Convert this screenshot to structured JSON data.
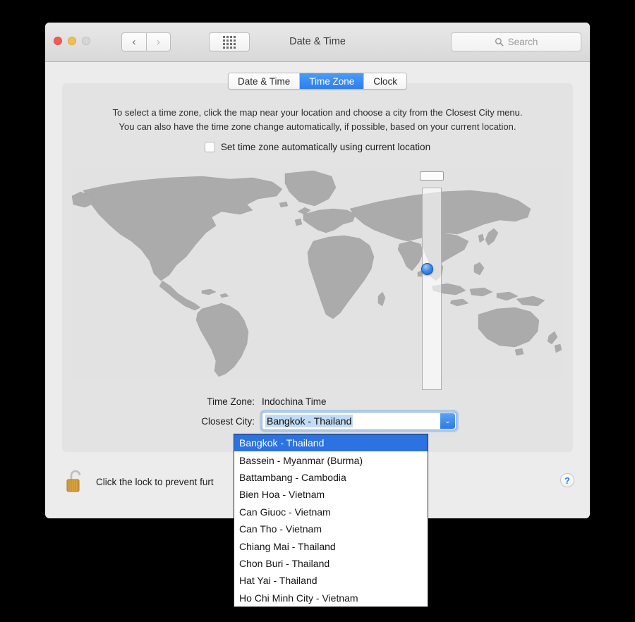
{
  "titlebar": {
    "title": "Date & Time",
    "traffic_lights": [
      "close-red",
      "minimize-yellow",
      "zoom-disabled"
    ],
    "back_glyph": "‹",
    "forward_glyph": "›",
    "grid_icon": "show-all-grid-icon",
    "search_placeholder": "Search",
    "search_icon": "search-icon"
  },
  "tabs": [
    {
      "label": "Date & Time",
      "active": false
    },
    {
      "label": "Time Zone",
      "active": true
    },
    {
      "label": "Clock",
      "active": false
    }
  ],
  "instructions": {
    "line1": "To select a time zone, click the map near your location and choose a city from the Closest City menu.",
    "line2": "You can also have the time zone change automatically, if possible, based on your current location."
  },
  "auto_checkbox": {
    "label": "Set time zone automatically using current location",
    "checked": false
  },
  "map": {
    "marker_name": "location-marker",
    "zone_band_name": "timezone-highlight-band",
    "zone_label_text": ""
  },
  "fields": {
    "time_zone_label": "Time Zone:",
    "time_zone_value": "Indochina Time",
    "closest_city_label": "Closest City:",
    "closest_city_value": "Bangkok - Thailand",
    "dropdown_arrow_glyph": "⌄"
  },
  "dropdown": {
    "items": [
      "Bangkok - Thailand",
      "Bassein - Myanmar (Burma)",
      "Battambang - Cambodia",
      "Bien Hoa - Vietnam",
      "Can Giuoc - Vietnam",
      "Can Tho - Vietnam",
      "Chiang Mai - Thailand",
      "Chon Buri - Thailand",
      "Hat Yai - Thailand",
      "Ho Chi Minh City - Vietnam"
    ],
    "selected_index": 0
  },
  "bottom": {
    "lock_icon": "unlocked-padlock-icon",
    "lock_text": "Click the lock to prevent furt",
    "help_label": "?"
  },
  "colors": {
    "accent_blue": "#2f7ee0",
    "selection_blue": "#2c72e0",
    "window_bg": "#ececec",
    "panel_bg": "#e3e3e3",
    "map_land": "#ababab",
    "map_sea": "#e2e2e2"
  }
}
